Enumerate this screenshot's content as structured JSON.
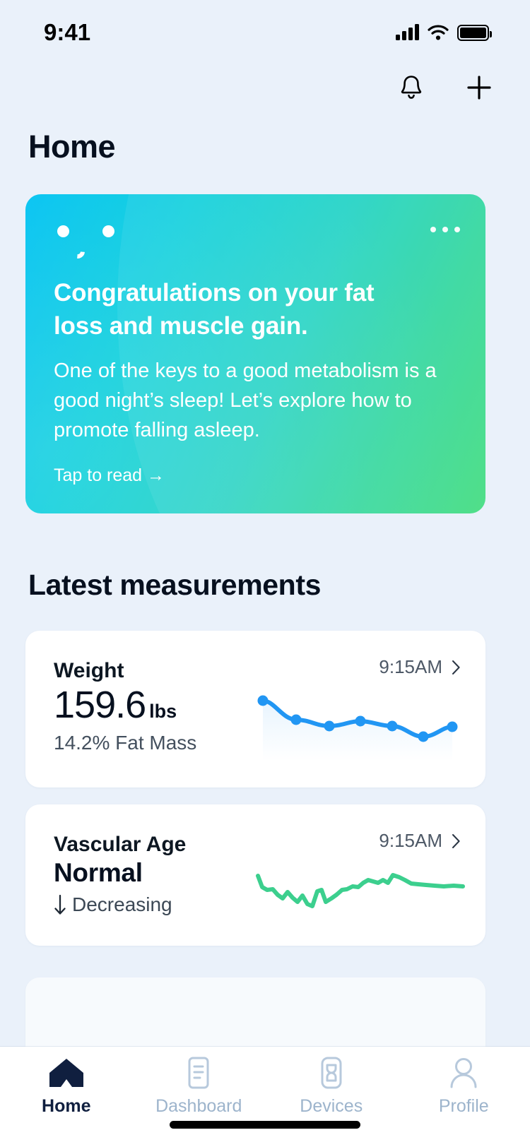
{
  "status_bar": {
    "time": "9:41",
    "signal_icon": "cellular-signal-icon",
    "wifi_icon": "wifi-icon",
    "battery_icon": "battery-icon"
  },
  "header": {
    "title": "Home",
    "notifications_icon": "bell-icon",
    "add_icon": "plus-icon"
  },
  "hero": {
    "logo_icon": "smiley-face-logo-icon",
    "more_icon": "more-options-icon",
    "title": "Congratulations on your fat loss and muscle gain.",
    "body": "One of the keys to a good metabolism is a good night’s sleep! Let’s explore how to promote falling asleep.",
    "cta": "Tap to read  →",
    "gradient_start": "#00c2f2",
    "gradient_end": "#44dd80"
  },
  "section": {
    "heading": "Latest measurements"
  },
  "measurements": [
    {
      "label": "Weight",
      "value": "159.6",
      "unit": "lbs",
      "sub": "14.2% Fat Mass",
      "time": "9:15AM",
      "chevron_icon": "chevron-right-icon",
      "accent": "#2196f3"
    },
    {
      "label": "Vascular Age",
      "status": "Normal",
      "trend_arrow": "↓",
      "trend": "Decreasing",
      "time": "9:15AM",
      "chevron_icon": "chevron-right-icon",
      "accent": "#3ccf8e"
    }
  ],
  "chart_data": [
    {
      "type": "line",
      "title": "Weight trend sparkline",
      "series": [
        {
          "name": "Weight (lbs)",
          "x": [
            0,
            1,
            2,
            3,
            4,
            5,
            6
          ],
          "values": [
            162.4,
            160.6,
            160.0,
            160.5,
            160.0,
            159.0,
            159.9
          ]
        }
      ],
      "markers": true,
      "color": "#2196f3",
      "ylim": [
        158.6,
        163.0
      ],
      "grid": false,
      "xlabel": "",
      "ylabel": ""
    },
    {
      "type": "line",
      "title": "Vascular age trend sparkline",
      "series": [
        {
          "name": "Vascular Age",
          "x": [
            0,
            1,
            2,
            3,
            4,
            5,
            6,
            7,
            8,
            9,
            10,
            11,
            12,
            13,
            14,
            15,
            16,
            17,
            18,
            19,
            20,
            21,
            22,
            23,
            24,
            25,
            26,
            27,
            28,
            29,
            30
          ],
          "values": [
            72,
            58,
            55,
            56,
            46,
            40,
            49,
            41,
            36,
            44,
            33,
            30,
            48,
            50,
            35,
            40,
            45,
            52,
            53,
            57,
            56,
            62,
            67,
            64,
            62,
            67,
            62,
            73,
            70,
            66,
            61
          ]
        }
      ],
      "markers": false,
      "color": "#3ccf8e",
      "ylim": [
        25,
        80
      ],
      "grid": false,
      "xlabel": "",
      "ylabel": ""
    }
  ],
  "bottom_nav": {
    "items": [
      {
        "label": "Home",
        "icon": "home-icon",
        "active": true
      },
      {
        "label": "Dashboard",
        "icon": "dashboard-document-icon",
        "active": false
      },
      {
        "label": "Devices",
        "icon": "smartwatch-device-icon",
        "active": false
      },
      {
        "label": "Profile",
        "icon": "person-profile-icon",
        "active": false
      }
    ],
    "active_color": "#101f3f",
    "inactive_color": "#9db4cc"
  }
}
